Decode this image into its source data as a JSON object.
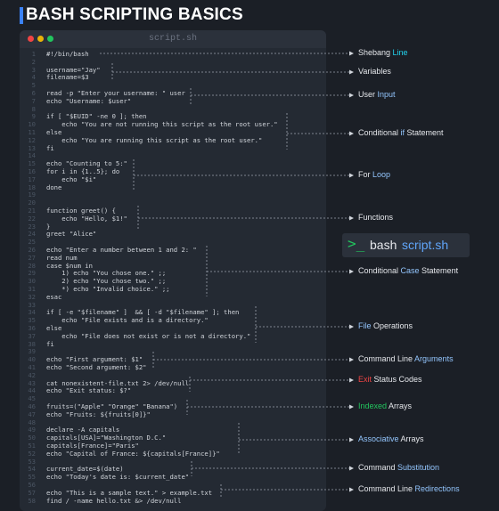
{
  "title": "BASH SCRIPTING BASICS",
  "editor": {
    "filename": "script.sh"
  },
  "code_lines": [
    {
      "n": "1",
      "t": "#!/bin/bash"
    },
    {
      "n": "2",
      "t": ""
    },
    {
      "n": "3",
      "t": "username=\"Jay\""
    },
    {
      "n": "4",
      "t": "filename=$3"
    },
    {
      "n": "5",
      "t": ""
    },
    {
      "n": "6",
      "t": "read -p \"Enter your username: \" user"
    },
    {
      "n": "7",
      "t": "echo \"Username: $user\""
    },
    {
      "n": "8",
      "t": ""
    },
    {
      "n": "9",
      "t": "if [ \"$EUID\" -ne 0 ]; then"
    },
    {
      "n": "10",
      "t": "    echo \"You are not running this script as the root user.\""
    },
    {
      "n": "11",
      "t": "else"
    },
    {
      "n": "12",
      "t": "    echo \"You are running this script as the root user.\""
    },
    {
      "n": "13",
      "t": "fi"
    },
    {
      "n": "14",
      "t": ""
    },
    {
      "n": "15",
      "t": "echo \"Counting to 5:\""
    },
    {
      "n": "16",
      "t": "for i in {1..5}; do"
    },
    {
      "n": "17",
      "t": "    echo \"$i\""
    },
    {
      "n": "18",
      "t": "done"
    },
    {
      "n": "19",
      "t": ""
    },
    {
      "n": "20",
      "t": ""
    },
    {
      "n": "21",
      "t": "function greet() {"
    },
    {
      "n": "22",
      "t": "    echo \"Hello, $1!\""
    },
    {
      "n": "23",
      "t": "}"
    },
    {
      "n": "24",
      "t": "greet \"Alice\""
    },
    {
      "n": "25",
      "t": ""
    },
    {
      "n": "26",
      "t": "echo \"Enter a number between 1 and 2: \""
    },
    {
      "n": "27",
      "t": "read num"
    },
    {
      "n": "28",
      "t": "case $num in"
    },
    {
      "n": "29",
      "t": "    1) echo \"You chose one.\" ;;"
    },
    {
      "n": "30",
      "t": "    2) echo \"You chose two.\" ;;"
    },
    {
      "n": "31",
      "t": "    *) echo \"Invalid choice.\" ;;"
    },
    {
      "n": "32",
      "t": "esac"
    },
    {
      "n": "33",
      "t": ""
    },
    {
      "n": "34",
      "t": "if [ -e \"$filename\" ]  && [ -d \"$filename\" ]; then"
    },
    {
      "n": "35",
      "t": "    echo \"File exists and is a directory.\""
    },
    {
      "n": "36",
      "t": "else"
    },
    {
      "n": "37",
      "t": "    echo \"File does not exist or is not a directory.\""
    },
    {
      "n": "38",
      "t": "fi"
    },
    {
      "n": "39",
      "t": ""
    },
    {
      "n": "40",
      "t": "echo \"First argument: $1\""
    },
    {
      "n": "41",
      "t": "echo \"Second argument: $2\""
    },
    {
      "n": "42",
      "t": ""
    },
    {
      "n": "43",
      "t": "cat nonexistent-file.txt 2> /dev/null"
    },
    {
      "n": "44",
      "t": "echo \"Exit status: $?\""
    },
    {
      "n": "45",
      "t": ""
    },
    {
      "n": "46",
      "t": "fruits=(\"Apple\" \"Orange\" \"Banana\")"
    },
    {
      "n": "47",
      "t": "echo \"Fruits: ${fruits[0]}\""
    },
    {
      "n": "48",
      "t": ""
    },
    {
      "n": "49",
      "t": "declare -A capitals"
    },
    {
      "n": "50",
      "t": "capitals[USA]=\"Washington D.C.\""
    },
    {
      "n": "51",
      "t": "capitals[France]=\"Paris\""
    },
    {
      "n": "52",
      "t": "echo \"Capital of France: ${capitals[France]}\""
    },
    {
      "n": "53",
      "t": ""
    },
    {
      "n": "54",
      "t": "current_date=$(date)"
    },
    {
      "n": "55",
      "t": "echo \"Today's date is: $current_date\""
    },
    {
      "n": "56",
      "t": ""
    },
    {
      "n": "57",
      "t": "echo \"This is a sample text.\" > example.txt"
    },
    {
      "n": "58",
      "t": "find / -name hello.txt &> /dev/null"
    }
  ],
  "labels": [
    {
      "a": "Shebang",
      "b": " Line",
      "c": ""
    },
    {
      "a": "Variables",
      "b": "",
      "c": ""
    },
    {
      "a": "User ",
      "b": "Input",
      "c": ""
    },
    {
      "a": "Conditional ",
      "b": "if",
      "c": " Statement"
    },
    {
      "a": "For ",
      "b": "Loop",
      "c": ""
    },
    {
      "a": "Functions",
      "b": "",
      "c": ""
    },
    {
      "a": "Conditional ",
      "b": "Case",
      "c": " Statement"
    },
    {
      "a": "",
      "b": "File",
      "c": " Operations"
    },
    {
      "a": "Command Line ",
      "b": "Arguments",
      "c": ""
    },
    {
      "a": "",
      "b": "Exit",
      "c": " Status Codes"
    },
    {
      "a": "",
      "b": "Indexed",
      "c": " Arrays"
    },
    {
      "a": "",
      "b": "Associative",
      "c": " Arrays"
    },
    {
      "a": "Command ",
      "b": "Substitution",
      "c": ""
    },
    {
      "a": "Command Line ",
      "b": "Redirections",
      "c": ""
    }
  ],
  "badge": {
    "prompt": ">_",
    "word": "bash",
    "file": "script.sh"
  },
  "colors": {
    "accent": "#3b82f6",
    "label_highlight": "#93c5fd",
    "exit_highlight": "#ef4444",
    "indexed_highlight": "#22c55e",
    "shebang_highlight": "#22d3ee"
  }
}
